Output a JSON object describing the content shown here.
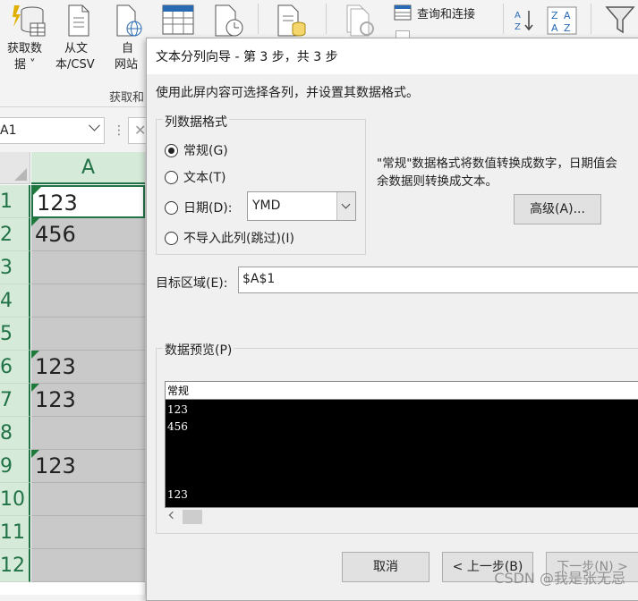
{
  "ribbon": {
    "get_data_label": "获取数据",
    "get_data_l1": "获取数",
    "get_data_l2": "据 ˅",
    "from_csv_l1": "从文",
    "from_csv_l2": "本/CSV",
    "from_web_l1": "自",
    "from_web_l2": "网站",
    "query_link_label": "查询和连接",
    "group_label": "获取和",
    "sort_az": "A↓Z",
    "accent_color": "#217346"
  },
  "formula_bar": {
    "name_box": "A1",
    "dots": "⋮"
  },
  "sheet": {
    "column_header": "A",
    "rows": [
      {
        "num": "1",
        "value": "123",
        "flag": true
      },
      {
        "num": "2",
        "value": "456",
        "flag": true
      },
      {
        "num": "3",
        "value": "",
        "flag": false
      },
      {
        "num": "4",
        "value": "",
        "flag": false
      },
      {
        "num": "5",
        "value": "",
        "flag": false
      },
      {
        "num": "6",
        "value": "123",
        "flag": true
      },
      {
        "num": "7",
        "value": "123",
        "flag": true
      },
      {
        "num": "8",
        "value": "",
        "flag": false
      },
      {
        "num": "9",
        "value": "123",
        "flag": true
      },
      {
        "num": "10",
        "value": "",
        "flag": false
      },
      {
        "num": "11",
        "value": "",
        "flag": false
      },
      {
        "num": "12",
        "value": "",
        "flag": false
      }
    ]
  },
  "dialog": {
    "title": "文本分列向导 - 第 3 步，共 3 步",
    "description": "使用此屏内容可选择各列，并设置其数据格式。",
    "column_format_legend": "列数据格式",
    "radio_general": "常规(G)",
    "radio_text": "文本(T)",
    "radio_date": "日期(D):",
    "radio_skip": "不导入此列(跳过)(I)",
    "date_format_value": "YMD",
    "hint_line1": "\"常规\"数据格式将数值转换成数字，日期值会",
    "hint_line2": "余数据则转换成文本。",
    "advanced_button": "高级(A)...",
    "target_label": "目标区域(E):",
    "target_value": "$A$1",
    "preview_label": "数据预览(P)",
    "preview_header": "常规",
    "preview_rows": [
      "123",
      "456",
      "",
      "",
      "",
      "123"
    ],
    "cancel_button": "取消",
    "back_button": "< 上一步(B)",
    "next_button": "下一步(N) >"
  },
  "watermark": "CSDN @我是张无忌"
}
